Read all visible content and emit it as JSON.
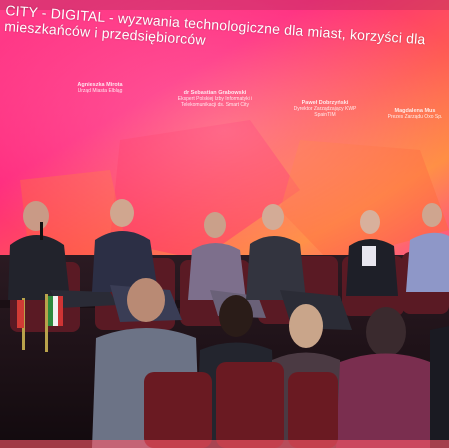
{
  "screen": {
    "headline": "CITY - DIGITAL - wyzwania technologiczne dla miast, korzyści dla mieszkańców i przedsiębiorców"
  },
  "speakers": [
    {
      "name": "Agnieszka Mirota",
      "role": "Urząd Miasta Elbląg"
    },
    {
      "name": "dr Sebastian Grabowski",
      "role": "Ekspert Polskiej Izby Informatyki i Telekomunikacji ds. Smart City"
    },
    {
      "name": "Paweł Dobrzyński",
      "role": "Dyrektor Zarządzający KWP SpainTIM"
    },
    {
      "name": "Magdalena Mus",
      "role": "Prezes Zarządu Oxo Sp."
    }
  ],
  "colors": {
    "screen_pink": "#ff2f8f",
    "screen_orange": "#ff7a3c",
    "stage_dark": "#2a1420",
    "chair_red": "#6a1a22"
  }
}
